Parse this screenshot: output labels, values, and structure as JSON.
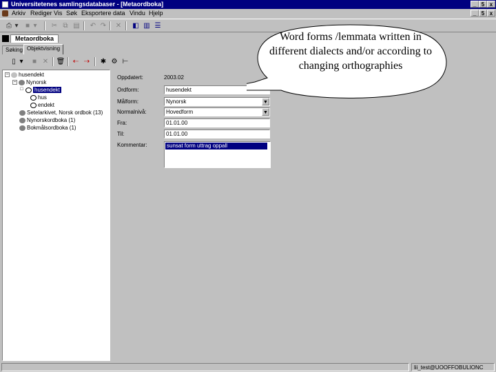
{
  "window": {
    "title": "Universitetenes samlingsdatabaser - [Metaordboka]",
    "controls": {
      "minimize": "_",
      "maximize": "5",
      "close": "x"
    }
  },
  "menu": {
    "items": [
      "Arkiv",
      "Rediger",
      "Vis",
      "Søk",
      "Eksportere data",
      "Vindu",
      "Hjelp"
    ]
  },
  "document_tab": "Metaordboka",
  "subtabs": [
    "Søking",
    "Objektvisning"
  ],
  "tree": {
    "nodes": [
      {
        "label": "husendekt",
        "level": 0,
        "expander": "−"
      },
      {
        "label": "Nynorsk",
        "level": 1,
        "expander": "−"
      },
      {
        "label": "husendekt",
        "level": 2,
        "expander": "□",
        "selected": true
      },
      {
        "label": "hus",
        "level": 3,
        "expander": ""
      },
      {
        "label": "endekt",
        "level": 3,
        "expander": ""
      },
      {
        "label": "Setelarkivet, Norsk ordbok (13)",
        "level": 1,
        "expander": ""
      },
      {
        "label": "Nynorskordboka (1)",
        "level": 1,
        "expander": ""
      },
      {
        "label": "Bokmålsordboka (1)",
        "level": 1,
        "expander": ""
      }
    ]
  },
  "form": {
    "endret_label": "Oppdatert:",
    "endret_value": "2003.02",
    "form_label": "Ordform:",
    "form_value": "husendekt",
    "maalform_label": "Målform:",
    "maalform_value": "Nynorsk",
    "normal_label": "Normalnivå:",
    "normal_value": "Hovedform",
    "fra_label": "Fra:",
    "fra_value": "01.01.00",
    "til_label": "Til:",
    "til_value": "01.01.00",
    "kommentar_label": "Kommentar:",
    "kommentar_value": "sunsat form uttrag oppall"
  },
  "callout": {
    "text": "Word forms /lemmata written in different dialects and/or according to changing orthographies"
  },
  "status": {
    "user": "lii_test@UOOFFOBULIONC"
  },
  "colors": {
    "titlebar": "#000080",
    "face": "#c0c0c0",
    "selection": "#000080"
  }
}
